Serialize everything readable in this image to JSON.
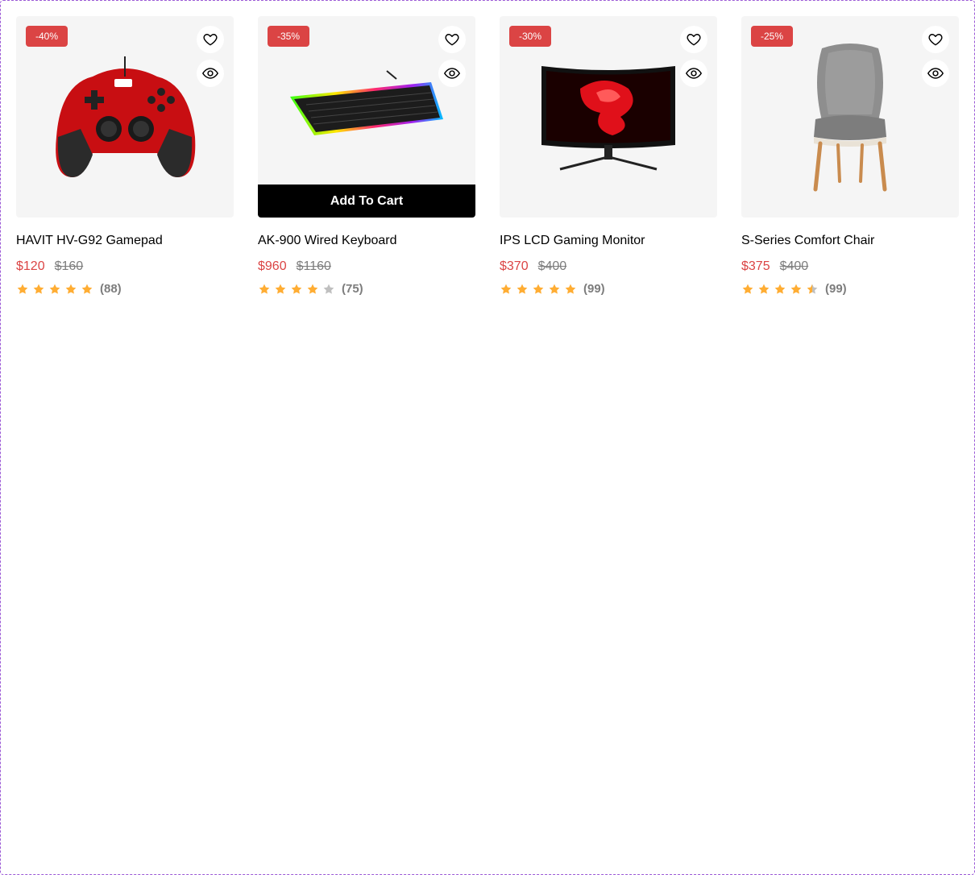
{
  "products": [
    {
      "discount": "-40%",
      "name": "HAVIT HV-G92 Gamepad",
      "price": "$120",
      "old_price": "$160",
      "rating": 5,
      "reviews": "(88)",
      "image": "gamepad",
      "show_cart": false
    },
    {
      "discount": "-35%",
      "name": "AK-900 Wired Keyboard",
      "price": "$960",
      "old_price": "$1160",
      "rating": 4,
      "reviews": "(75)",
      "image": "keyboard",
      "show_cart": true
    },
    {
      "discount": "-30%",
      "name": "IPS LCD Gaming Monitor",
      "price": "$370",
      "old_price": "$400",
      "rating": 5,
      "reviews": "(99)",
      "image": "monitor",
      "show_cart": false
    },
    {
      "discount": "-25%",
      "name": "S-Series Comfort Chair",
      "price": "$375",
      "old_price": "$400",
      "rating": 4.5,
      "reviews": "(99)",
      "image": "chair",
      "show_cart": false
    }
  ],
  "cart_label": "Add To Cart",
  "icons": {
    "wishlist": "heart-icon",
    "quick_view": "eye-icon",
    "star": "star-icon"
  },
  "colors": {
    "accent": "#DB4444",
    "star": "#FFAD33",
    "star_empty": "#BFBFBF",
    "card_bg": "#F5F5F5"
  }
}
